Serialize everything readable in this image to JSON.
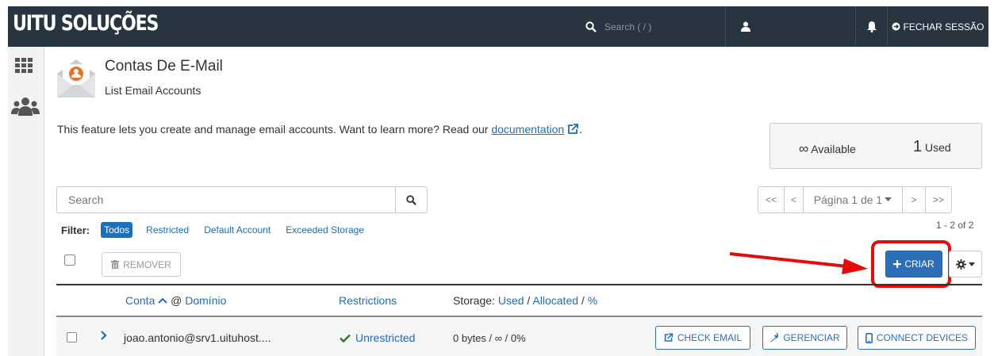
{
  "topbar": {
    "brand": "UITU SOLUÇÕES",
    "search_placeholder": "Search ( / )",
    "logout_label": "FECHAR SESSÃO",
    "bg_color": "#283540"
  },
  "header": {
    "title": "Contas De E-Mail",
    "subtitle": "List Email Accounts",
    "icon": "email-envelope-icon"
  },
  "description": {
    "text": "This feature lets you create and manage email accounts. Want to learn more? Read our",
    "link": "documentation",
    "trailing": "."
  },
  "stats": {
    "available_symbol": "∞",
    "available_label": "Available",
    "used_count": "1",
    "used_label": "Used"
  },
  "search": {
    "placeholder": "Search"
  },
  "filter": {
    "label": "Filter:",
    "options": [
      "Todos",
      "Restricted",
      "Default Account",
      "Exceeded Storage"
    ],
    "active": "Todos"
  },
  "pagination": {
    "first": "<<",
    "prev": "<",
    "page": "Página 1 de 1",
    "next": ">",
    "last": ">>",
    "count": "1 - 2 of 2"
  },
  "toolbar": {
    "remove_label": "REMOVER",
    "create_label": "CRIAR",
    "accent": "#2c6fb8",
    "highlight_color": "#e40b0b"
  },
  "table": {
    "col_account": "Conta",
    "col_at": "@",
    "col_domain": "Domínio",
    "col_restrictions": "Restrictions",
    "col_storage_prefix": "Storage:",
    "col_storage_used": "Used",
    "col_storage_sep1": "/",
    "col_storage_allocated": "Allocated",
    "col_storage_sep2": "/",
    "col_storage_pct": "%",
    "rows": [
      {
        "email": "joao.antonio@srv1.uituhost....",
        "restriction": "Unrestricted",
        "storage": "0 bytes / ∞ / 0%",
        "actions": [
          "CHECK EMAIL",
          "GERENCIAR",
          "CONNECT DEVICES"
        ]
      }
    ]
  }
}
